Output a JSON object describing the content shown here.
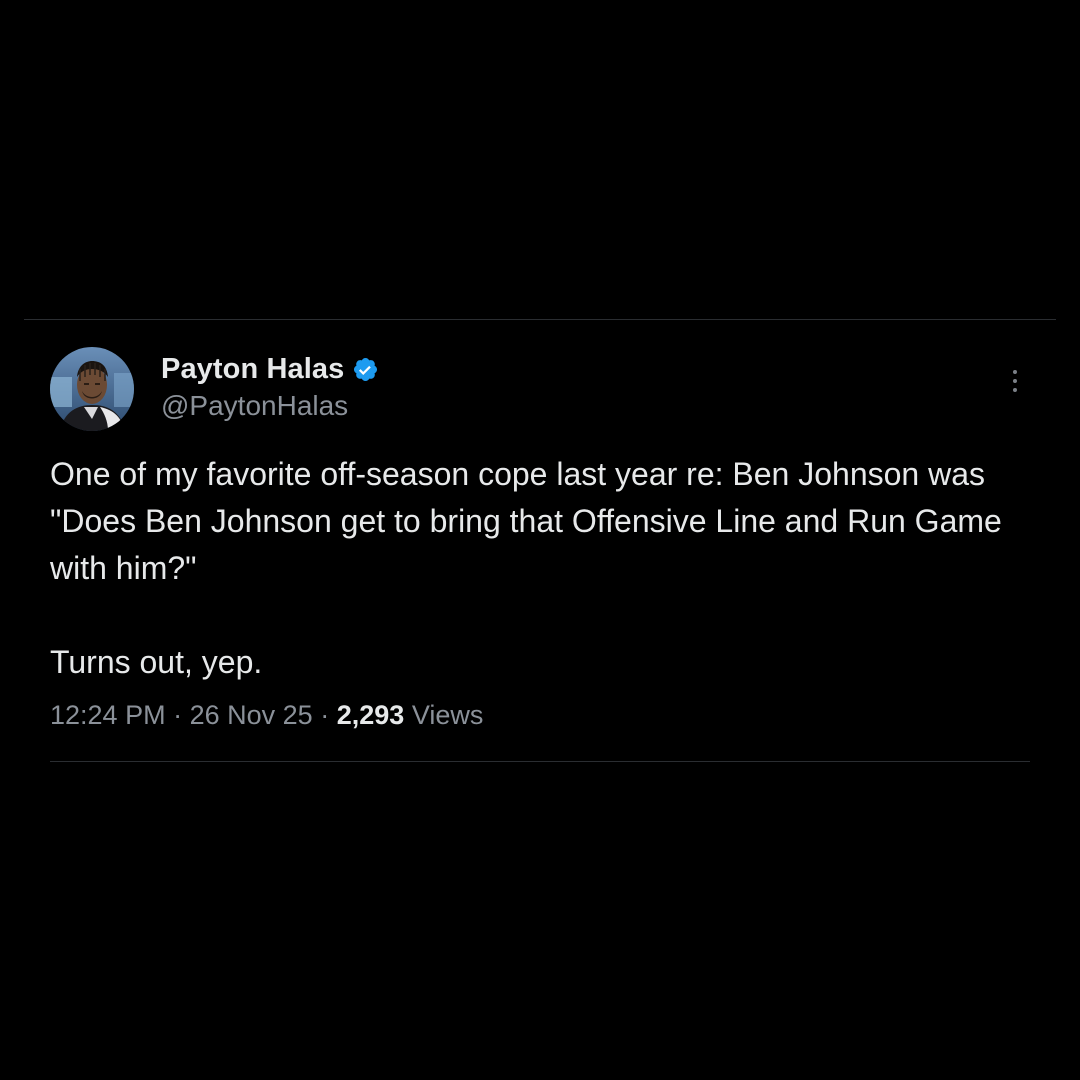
{
  "tweet": {
    "author": {
      "display_name": "Payton Halas",
      "handle": "@PaytonHalas",
      "verified": true,
      "avatar_icon": "user-avatar"
    },
    "body": {
      "paragraph_1": "One of my favorite off-season cope last year re: Ben Johnson was \"Does Ben Johnson get to bring that Offensive Line and Run Game with him?\"",
      "paragraph_2": "Turns out, yep."
    },
    "meta": {
      "time": "12:24 PM",
      "separator": "·",
      "date": "26 Nov 25",
      "views_count": "2,293",
      "views_label": "Views"
    },
    "more_icon": "more-vertical-icon"
  },
  "colors": {
    "background": "#000000",
    "text_primary": "#e7e9ea",
    "text_secondary": "#8b9199",
    "verified_blue": "#1d9bf0",
    "divider": "#2a2d31"
  }
}
